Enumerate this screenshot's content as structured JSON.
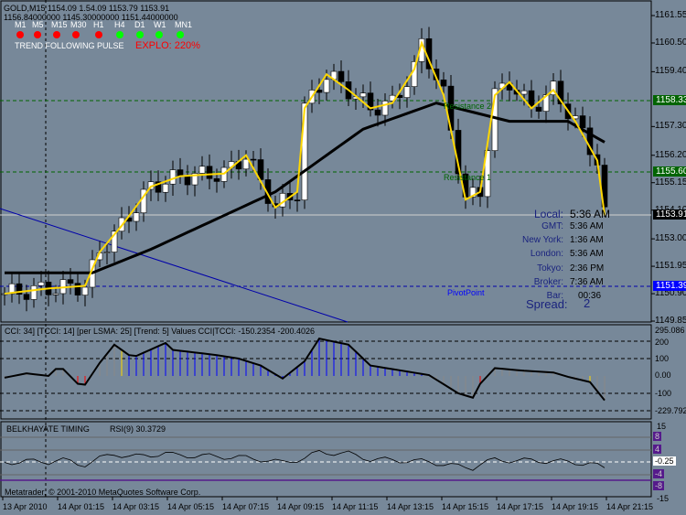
{
  "header": {
    "line1": "GOLD,M15  1154.09 1.54.09 1153.79 1153.91",
    "line2": "1156.84000000 1145.30000000 1151.44000000",
    "timeframes": [
      {
        "label": "M1",
        "color": "#ff0000"
      },
      {
        "label": "M5",
        "color": "#ff0000"
      },
      {
        "label": "M15",
        "color": "#ff0000"
      },
      {
        "label": "M30",
        "color": "#ff0000"
      },
      {
        "label": "H1",
        "color": "#ff0000"
      },
      {
        "label": "H4",
        "color": "#00ff00"
      },
      {
        "label": "D1",
        "color": "#00ff00"
      },
      {
        "label": "W1",
        "color": "#00ff00"
      },
      {
        "label": "MN1",
        "color": "#00ff00"
      }
    ],
    "trend": "TREND FOLLOWING  PULSE",
    "explo": "EXPLO: 220%"
  },
  "price_axis": [
    "1161.55",
    "1160.50",
    "1159.40",
    "1157.30",
    "1156.20",
    "1155.15",
    "1154.10",
    "1153.00",
    "1151.95",
    "1150.90",
    "1149.85"
  ],
  "price_tags": {
    "r2": "1158.33",
    "r1": "1155.60",
    "bid": "1153.91",
    "pivot": "1151.39"
  },
  "levels": {
    "r2_label": "Resistance 2",
    "r1_label": "Resistance 1",
    "pivot_label": "PivotPoint"
  },
  "clock": {
    "local_label": "Local:",
    "local": "5:36 AM",
    "rows": [
      {
        "k": "GMT:",
        "v": "5:36 AM"
      },
      {
        "k": "New York:",
        "v": "1:36 AM"
      },
      {
        "k": "London:",
        "v": "5:36 AM"
      },
      {
        "k": "Tokyo:",
        "v": "2:36 PM"
      },
      {
        "k": "Broker:",
        "v": "7:36 AM"
      },
      {
        "k": "Bar:",
        "v": "00:36"
      }
    ],
    "spread_label": "Spread:",
    "spread": "2"
  },
  "price_keys": [
    [
      0,
      1150.9
    ],
    [
      6,
      1151.1
    ],
    [
      11,
      1151.2
    ],
    [
      13,
      1152.5
    ],
    [
      16,
      1153.5
    ],
    [
      20,
      1155.0
    ],
    [
      24,
      1155.4
    ],
    [
      30,
      1155.5
    ],
    [
      33,
      1156.2
    ],
    [
      37,
      1154.2
    ],
    [
      40,
      1154.8
    ],
    [
      41,
      1158.0
    ],
    [
      44,
      1159.3
    ],
    [
      47,
      1158.7
    ],
    [
      50,
      1158.0
    ],
    [
      53,
      1158.2
    ],
    [
      56,
      1159.5
    ],
    [
      57,
      1160.5
    ],
    [
      60,
      1158.5
    ],
    [
      63,
      1154.5
    ],
    [
      65,
      1154.8
    ],
    [
      67,
      1158.5
    ],
    [
      69,
      1159.0
    ],
    [
      72,
      1158.0
    ],
    [
      75,
      1158.7
    ],
    [
      78,
      1157.5
    ],
    [
      81,
      1156.0
    ],
    [
      82,
      1153.9
    ]
  ],
  "ma_keys": [
    [
      0,
      1151.7
    ],
    [
      12,
      1151.7
    ],
    [
      20,
      1152.6
    ],
    [
      37,
      1154.8
    ],
    [
      49,
      1157.2
    ],
    [
      59,
      1158.2
    ],
    [
      69,
      1157.5
    ],
    [
      77,
      1157.5
    ],
    [
      82,
      1156.7
    ]
  ],
  "cci": {
    "title": "CCI: 34] [TCCI: 14] [per LSMA: 25] [Trend: 5] Values CCI|TCCI: -150.2354 -200.4026",
    "axis": [
      "295.086",
      "200",
      "100",
      "0.00",
      "-100",
      "-229.792"
    ],
    "keys": [
      [
        0,
        -10
      ],
      [
        3,
        15
      ],
      [
        6,
        0
      ],
      [
        7,
        40
      ],
      [
        8,
        40
      ],
      [
        10,
        -45
      ],
      [
        11,
        -50
      ],
      [
        13,
        75
      ],
      [
        15,
        180
      ],
      [
        17,
        120
      ],
      [
        18,
        115
      ],
      [
        22,
        190
      ],
      [
        23,
        150
      ],
      [
        29,
        120
      ],
      [
        32,
        100
      ],
      [
        35,
        60
      ],
      [
        38,
        -15
      ],
      [
        41,
        85
      ],
      [
        43,
        215
      ],
      [
        47,
        180
      ],
      [
        50,
        60
      ],
      [
        58,
        5
      ],
      [
        62,
        -100
      ],
      [
        64,
        -125
      ],
      [
        65,
        -45
      ],
      [
        67,
        45
      ],
      [
        71,
        30
      ],
      [
        75,
        20
      ],
      [
        77,
        -5
      ],
      [
        80,
        -35
      ],
      [
        82,
        -140
      ]
    ]
  },
  "rsi": {
    "title": "BELKHAYATE TIMING",
    "value": "RSI(9) 30.3729",
    "axis": [
      "15",
      "8",
      "4",
      "-0.25",
      "-4",
      "-8",
      "-15"
    ]
  },
  "footer": "Metatrader, © 2001-2010 MetaQuotes Software Corp.",
  "time_axis": [
    "13 Apr 2010",
    "14 Apr 01:15",
    "14 Apr 03:15",
    "14 Apr 05:15",
    "14 Apr 07:15",
    "14 Apr 09:15",
    "14 Apr 11:15",
    "14 Apr 13:15",
    "14 Apr 15:15",
    "14 Apr 17:15",
    "14 Apr 19:15",
    "14 Apr 21:15"
  ]
}
